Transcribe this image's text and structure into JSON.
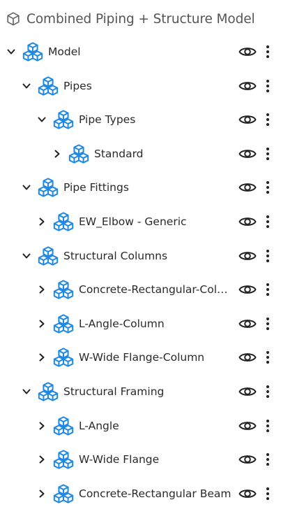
{
  "header": {
    "title": "Combined Piping + Structure Model",
    "icon": "cube-outline-icon"
  },
  "colors": {
    "icon_blue": "#1e88e5",
    "text": "#2a2a2a",
    "header_text": "#555555"
  },
  "tree": [
    {
      "label": "Model",
      "level": 0,
      "expanded": true,
      "icon": "model-cubes-icon"
    },
    {
      "label": "Pipes",
      "level": 1,
      "expanded": true,
      "icon": "category-cubes-icon"
    },
    {
      "label": "Pipe Types",
      "level": 2,
      "expanded": true,
      "icon": "category-cubes-icon"
    },
    {
      "label": "Standard",
      "level": 3,
      "expanded": false,
      "icon": "category-cubes-icon"
    },
    {
      "label": "Pipe Fittings",
      "level": 1,
      "expanded": true,
      "icon": "category-cubes-icon"
    },
    {
      "label": "EW_Elbow - Generic",
      "level": 2,
      "expanded": false,
      "icon": "category-cubes-icon"
    },
    {
      "label": "Structural Columns",
      "level": 1,
      "expanded": true,
      "icon": "category-cubes-icon"
    },
    {
      "label": "Concrete-Rectangular-Column",
      "level": 2,
      "expanded": false,
      "icon": "category-cubes-icon"
    },
    {
      "label": "L-Angle-Column",
      "level": 2,
      "expanded": false,
      "icon": "category-cubes-icon"
    },
    {
      "label": "W-Wide Flange-Column",
      "level": 2,
      "expanded": false,
      "icon": "category-cubes-icon"
    },
    {
      "label": "Structural Framing",
      "level": 1,
      "expanded": true,
      "icon": "category-cubes-icon"
    },
    {
      "label": "L-Angle",
      "level": 2,
      "expanded": false,
      "icon": "category-cubes-icon"
    },
    {
      "label": "W-Wide Flange",
      "level": 2,
      "expanded": false,
      "icon": "category-cubes-icon"
    },
    {
      "label": "Concrete-Rectangular Beam",
      "level": 2,
      "expanded": false,
      "icon": "category-cubes-icon"
    }
  ]
}
